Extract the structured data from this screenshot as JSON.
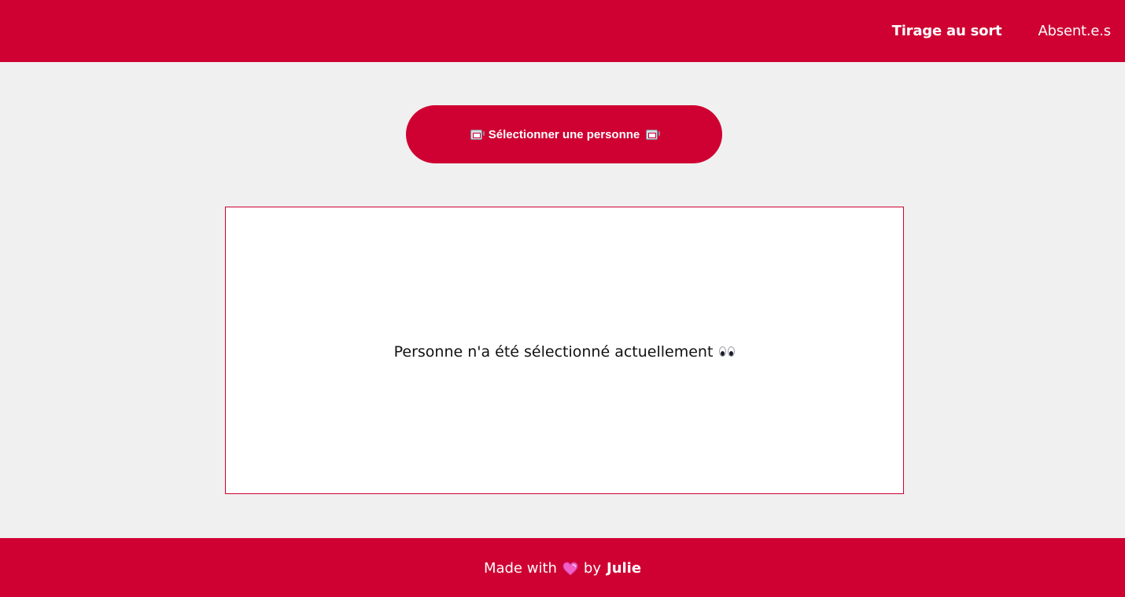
{
  "colors": {
    "brand": "#cf0032",
    "background": "#f0f0f0",
    "panel": "#ffffff",
    "text": "#111111",
    "heart": "#f25fc6"
  },
  "nav": {
    "items": [
      {
        "label": "Tirage au sort",
        "active": true
      },
      {
        "label": "Absent.e.s",
        "active": false
      }
    ]
  },
  "main": {
    "select_button": {
      "label": "Sélectionner une personne",
      "icon": "slot-machine-icon"
    },
    "result": {
      "text": "Personne n'a été sélectionné actuellement",
      "icon": "eyes-icon"
    }
  },
  "footer": {
    "made_with": "Made with",
    "heart_icon": "heart-icon",
    "by": "by",
    "author": "Julie"
  }
}
